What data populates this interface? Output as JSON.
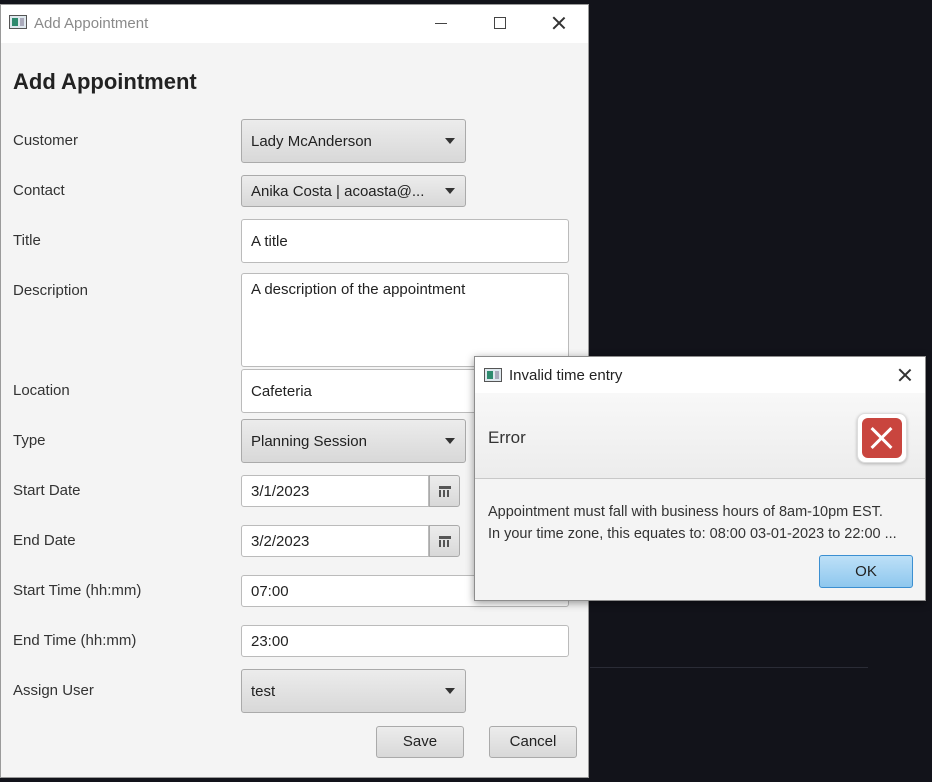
{
  "main_window": {
    "title": "Add Appointment",
    "heading": "Add Appointment",
    "form": {
      "customer_label": "Customer",
      "customer_value": "Lady McAnderson",
      "contact_label": "Contact",
      "contact_value": "Anika Costa | acoasta@...",
      "title_label": "Title",
      "title_value": "A title",
      "description_label": "Description",
      "description_value": "A description of the appointment",
      "location_label": "Location",
      "location_value": "Cafeteria",
      "type_label": "Type",
      "type_value": "Planning Session",
      "start_date_label": "Start Date",
      "start_date_value": "3/1/2023",
      "end_date_label": "End Date",
      "end_date_value": "3/2/2023",
      "start_time_label": "Start Time (hh:mm)",
      "start_time_value": "07:00",
      "end_time_label": "End Time (hh:mm)",
      "end_time_value": "23:00",
      "assign_user_label": "Assign User",
      "assign_user_value": "test"
    },
    "buttons": {
      "save": "Save",
      "cancel": "Cancel"
    }
  },
  "dialog": {
    "title": "Invalid time entry",
    "header": "Error",
    "message_line1": "Appointment must fall with business hours of 8am-10pm EST.",
    "message_line2": "In your time zone, this equates to: 08:00 03-01-2023  to 22:00 ...",
    "ok_label": "OK"
  },
  "icons": {
    "app": "app-window-icon",
    "calendar": "calendar-icon",
    "error": "error-x-icon"
  },
  "colors": {
    "desktop_bg": "#12131a",
    "error_red": "#c9453e",
    "ok_button": "#8ec7ee"
  }
}
